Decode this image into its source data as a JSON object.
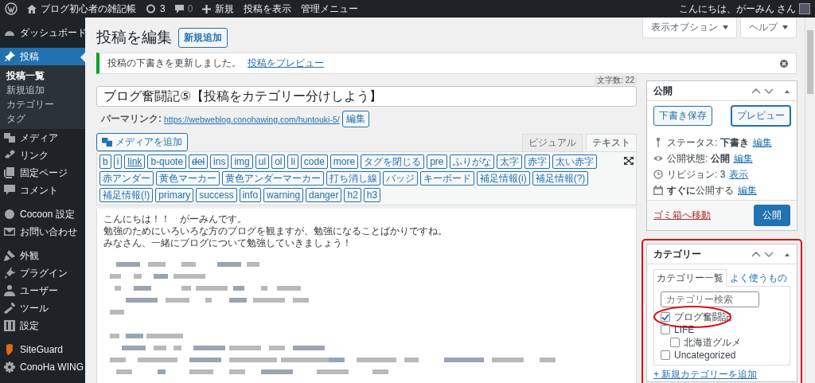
{
  "admin_bar": {
    "site_name": "ブログ初心者の雑記帳",
    "updates_count": "3",
    "comments_count": "0",
    "new_label": "新規",
    "view_post": "投稿を表示",
    "admin_menu": "管理メニュー",
    "greeting": "こんにちは、がーみん さん"
  },
  "sidebar": {
    "sections": [
      {
        "items": [
          {
            "label": "ダッシュボード",
            "selected": false
          }
        ]
      },
      {
        "items": [
          {
            "label": "投稿",
            "selected": true,
            "children": [
              {
                "label": "投稿一覧",
                "selected": true
              },
              {
                "label": "新規追加",
                "selected": false
              },
              {
                "label": "カテゴリー",
                "selected": false
              },
              {
                "label": "タグ",
                "selected": false
              }
            ]
          },
          {
            "label": "メディア",
            "selected": false
          },
          {
            "label": "リンク",
            "selected": false
          },
          {
            "label": "固定ページ",
            "selected": false
          },
          {
            "label": "コメント",
            "selected": false
          }
        ]
      },
      {
        "items": [
          {
            "label": "Cocoon 設定",
            "selected": false
          },
          {
            "label": "お問い合わせ",
            "selected": false
          }
        ]
      },
      {
        "items": [
          {
            "label": "外観",
            "selected": false
          },
          {
            "label": "プラグイン",
            "selected": false
          },
          {
            "label": "ユーザー",
            "selected": false
          },
          {
            "label": "ツール",
            "selected": false
          },
          {
            "label": "設定",
            "selected": false
          }
        ]
      },
      {
        "items": [
          {
            "label": "SiteGuard",
            "selected": false
          },
          {
            "label": "ConoHa WING",
            "selected": false
          }
        ]
      }
    ]
  },
  "screen_options": [
    "表示オプション",
    "ヘルプ"
  ],
  "page_title": "投稿を編集",
  "add_new": "新規追加",
  "notice": {
    "message": "投稿の下書きを更新しました。",
    "link": "投稿をプレビュー"
  },
  "char_count": "文字数: 22",
  "post_title": "ブログ奮闘記⑤【投稿をカテゴリー分けしよう】",
  "permalink": {
    "label": "パーマリンク:",
    "url": "https://webweblog.conohawing.com/huntouki-5/",
    "edit": "編集"
  },
  "add_media": "メディアを追加",
  "editor_tabs": [
    {
      "label": "ビジュアル",
      "selected": false
    },
    {
      "label": "テキスト",
      "selected": true
    }
  ],
  "quicktags": [
    {
      "label": "b",
      "kind": "plain"
    },
    {
      "label": "i",
      "kind": "plain"
    },
    {
      "label": "link",
      "kind": "underline"
    },
    {
      "label": "b-quote",
      "kind": "plain"
    },
    {
      "label": "del",
      "kind": "strike"
    },
    {
      "label": "ins",
      "kind": "plain"
    },
    {
      "label": "img",
      "kind": "plain"
    },
    {
      "label": "ul",
      "kind": "plain"
    },
    {
      "label": "ol",
      "kind": "plain"
    },
    {
      "label": "li",
      "kind": "plain"
    },
    {
      "label": "code",
      "kind": "plain"
    },
    {
      "label": "more",
      "kind": "plain"
    },
    {
      "label": "タグを閉じる",
      "kind": "plain"
    },
    {
      "label": "pre",
      "kind": "plain"
    },
    {
      "label": "ふりがな",
      "kind": "plain"
    },
    {
      "label": "太字",
      "kind": "plain"
    },
    {
      "label": "赤字",
      "kind": "plain"
    },
    {
      "label": "太い赤字",
      "kind": "plain"
    },
    {
      "label": "赤アンダー",
      "kind": "plain"
    },
    {
      "label": "黄色マーカー",
      "kind": "plain"
    },
    {
      "label": "黄色アンダーマーカー",
      "kind": "plain"
    },
    {
      "label": "打ち消し線",
      "kind": "plain"
    },
    {
      "label": "バッジ",
      "kind": "plain"
    },
    {
      "label": "キーボード",
      "kind": "plain"
    },
    {
      "label": "補足情報(i)",
      "kind": "plain"
    },
    {
      "label": "補足情報(?)",
      "kind": "plain"
    },
    {
      "label": "補足情報(!)",
      "kind": "plain"
    },
    {
      "label": "primary",
      "kind": "plain"
    },
    {
      "label": "success",
      "kind": "plain"
    },
    {
      "label": "info",
      "kind": "plain"
    },
    {
      "label": "warning",
      "kind": "plain"
    },
    {
      "label": "danger",
      "kind": "plain"
    },
    {
      "label": "h2",
      "kind": "plain"
    },
    {
      "label": "h3",
      "kind": "plain"
    }
  ],
  "editor_lines": [
    "こんにちは！！　がーみんです。",
    "勉強のためにいろいろな方のブログを観ますが、勉強になることばかりですね。",
    "みなさん、一緒にブログについて勉強していきましょう！"
  ],
  "publish_box": {
    "title": "公開",
    "save_draft": "下書き保存",
    "preview": "プレビュー",
    "rows": [
      {
        "text": "ステータス: **下書き**",
        "link": "編集"
      },
      {
        "text": "公開状態: **公開**",
        "link": "編集"
      },
      {
        "text": "リビジョン: 3",
        "link": "表示"
      },
      {
        "text": "**すぐに**公開する",
        "link": "編集"
      }
    ],
    "trash": "ゴミ箱へ移動",
    "publish": "公開"
  },
  "category_box": {
    "title": "カテゴリー",
    "highlighted": true,
    "tabs": [
      {
        "label": "カテゴリー一覧",
        "selected": true
      },
      {
        "label": "よく使うもの",
        "selected": false
      }
    ],
    "search": {
      "placeholder": "カテゴリー検索"
    },
    "categories": [
      {
        "label": "ブログ奮闘記",
        "checked": true,
        "circled": true
      },
      {
        "label": "LIFE",
        "checked": false,
        "circled": false,
        "children": [
          {
            "label": "北海道グルメ",
            "checked": false,
            "circled": false
          }
        ]
      },
      {
        "label": "Uncategorized",
        "checked": false,
        "circled": false
      }
    ],
    "add_link": "+ 新規カテゴリーを追加"
  }
}
